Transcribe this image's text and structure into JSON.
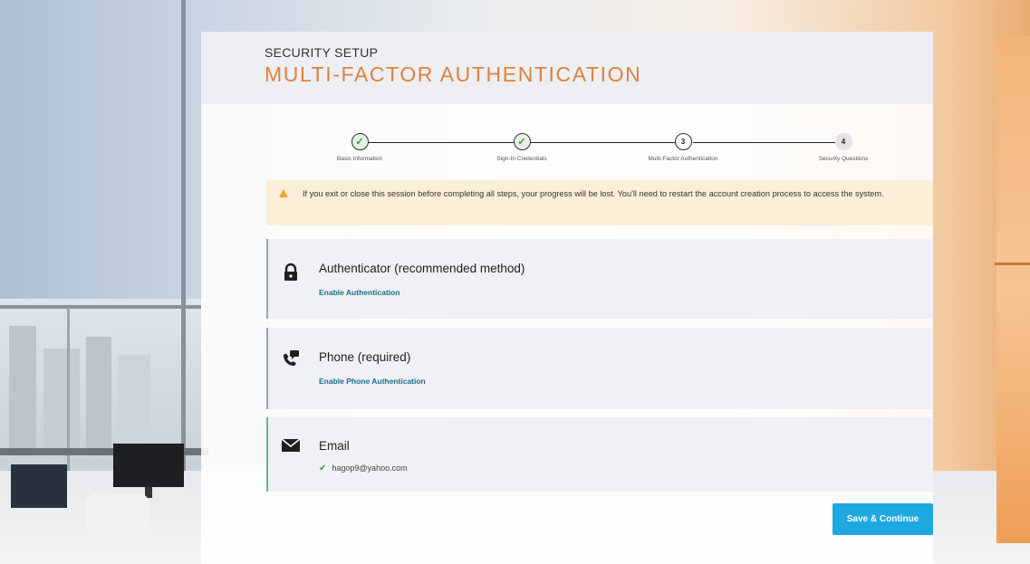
{
  "header": {
    "eyebrow": "SECURITY SETUP",
    "title": "MULTI-FACTOR AUTHENTICATION"
  },
  "stepper": {
    "steps": [
      {
        "label": "Basic Information",
        "state": "done",
        "marker": "✓"
      },
      {
        "label": "Sign-In Credentials",
        "state": "done",
        "marker": "✓"
      },
      {
        "label": "Multi-Factor Authentication",
        "state": "current",
        "marker": "3"
      },
      {
        "label": "Security Questions",
        "state": "todo",
        "marker": "4"
      }
    ]
  },
  "warning": {
    "icon": "warning-triangle-icon",
    "text": "If you exit or close this session before completing all steps, your progress will be lost. You'll need to restart the account creation process to access the system."
  },
  "methods": {
    "authenticator": {
      "icon": "lock-icon",
      "title": "Authenticator (recommended method)",
      "action": "Enable Authentication"
    },
    "phone": {
      "icon": "phone-chat-icon",
      "title": "Phone (required)",
      "action": "Enable Phone Authentication"
    },
    "email": {
      "icon": "envelope-icon",
      "title": "Email",
      "value": "hagop9@yahoo.com",
      "status": "verified"
    }
  },
  "actions": {
    "save_label": "Save & Continue"
  },
  "colors": {
    "accent_title": "#e0813f",
    "link": "#1d6d8c",
    "primary_button": "#1ea8e0",
    "success": "#3a9a3a",
    "warning_bg": "#fbefd8",
    "warning_icon": "#e9a92a"
  }
}
